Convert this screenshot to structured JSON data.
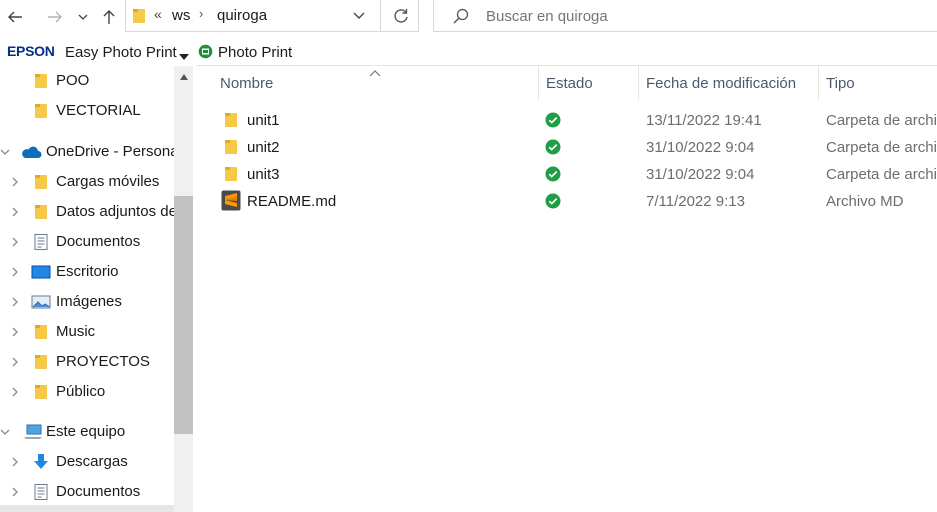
{
  "nav": {
    "back_icon": "arrow-left-icon",
    "forward_icon": "arrow-right-icon",
    "recent_icon": "chevron-down-icon",
    "up_icon": "arrow-up-icon",
    "refresh_icon": "refresh-icon"
  },
  "address": {
    "overflow": "«",
    "segments": [
      "ws",
      "quiroga"
    ]
  },
  "search": {
    "placeholder": "Buscar en quiroga"
  },
  "toolbar": {
    "brand": "EPSON",
    "app_label": "Easy Photo Print",
    "photo_print_label": "Photo Print"
  },
  "sidebar": {
    "items": [
      {
        "label": "POO",
        "icon": "folder-icon"
      },
      {
        "label": "VECTORIAL",
        "icon": "folder-icon"
      },
      {
        "label": "OneDrive - Personal",
        "icon": "onedrive-cloud-icon"
      },
      {
        "label": "Cargas móviles",
        "icon": "folder-icon"
      },
      {
        "label": "Datos adjuntos de",
        "icon": "folder-icon"
      },
      {
        "label": "Documentos",
        "icon": "document-icon"
      },
      {
        "label": "Escritorio",
        "icon": "desktop-icon"
      },
      {
        "label": "Imágenes",
        "icon": "pictures-icon"
      },
      {
        "label": "Music",
        "icon": "folder-icon"
      },
      {
        "label": "PROYECTOS",
        "icon": "folder-icon"
      },
      {
        "label": "Público",
        "icon": "folder-icon"
      },
      {
        "label": "Este equipo",
        "icon": "computer-icon"
      },
      {
        "label": "Descargas",
        "icon": "download-icon"
      },
      {
        "label": "Documentos",
        "icon": "document-icon"
      }
    ]
  },
  "columns": {
    "name": "Nombre",
    "status": "Estado",
    "modified": "Fecha de modificación",
    "type": "Tipo"
  },
  "files": [
    {
      "name": "unit1",
      "modified": "13/11/2022 19:41",
      "type": "Carpeta de archivos",
      "icon": "folder-icon",
      "status_icon": "synced-check-icon"
    },
    {
      "name": "unit2",
      "modified": "31/10/2022 9:04",
      "type": "Carpeta de archivos",
      "icon": "folder-icon",
      "status_icon": "synced-check-icon"
    },
    {
      "name": "unit3",
      "modified": "31/10/2022 9:04",
      "type": "Carpeta de archivos",
      "icon": "folder-icon",
      "status_icon": "synced-check-icon"
    },
    {
      "name": "README.md",
      "modified": "7/11/2022 9:13",
      "type": "Archivo MD",
      "icon": "sublime-text-file-icon",
      "status_icon": "synced-check-icon"
    }
  ],
  "colors": {
    "folder": "#f7c948",
    "folder_dark": "#e0a92a",
    "synced": "#1f9e44",
    "onedrive": "#0f6cbd",
    "epson": "#003087",
    "sublime": "#ff9800"
  }
}
